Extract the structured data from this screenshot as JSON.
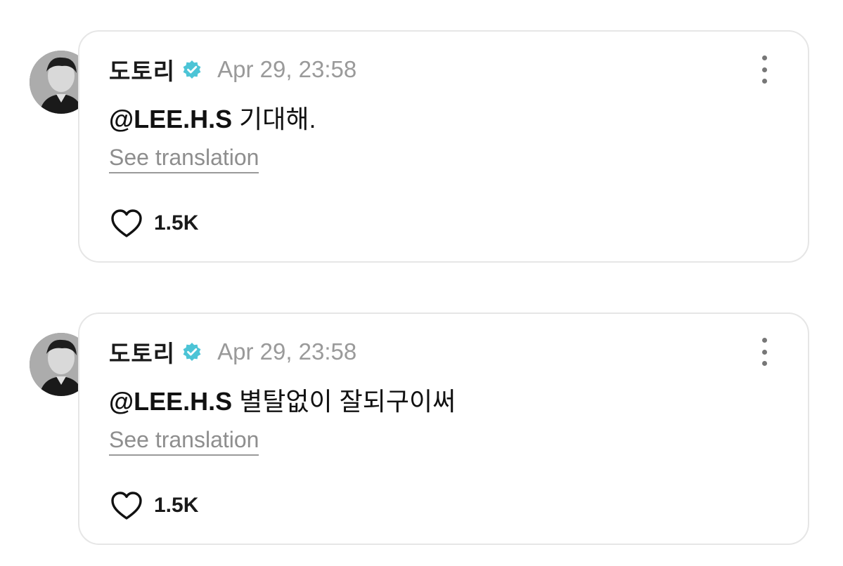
{
  "comments": [
    {
      "username": "도토리",
      "verified_icon": "verified-badge-icon",
      "timestamp": "Apr 29, 23:58",
      "mention": "@LEE.H.S",
      "text": " 기대해.",
      "translate_label": "See translation",
      "like_count": "1.5K"
    },
    {
      "username": "도토리",
      "verified_icon": "verified-badge-icon",
      "timestamp": "Apr 29, 23:58",
      "mention": "@LEE.H.S",
      "text": " 별탈없이 잘되구이써",
      "translate_label": "See translation",
      "like_count": "1.5K"
    }
  ],
  "colors": {
    "verified_badge": "#4cc4d6",
    "timestamp": "#9a9a9a",
    "card_border": "#e6e6e6"
  }
}
